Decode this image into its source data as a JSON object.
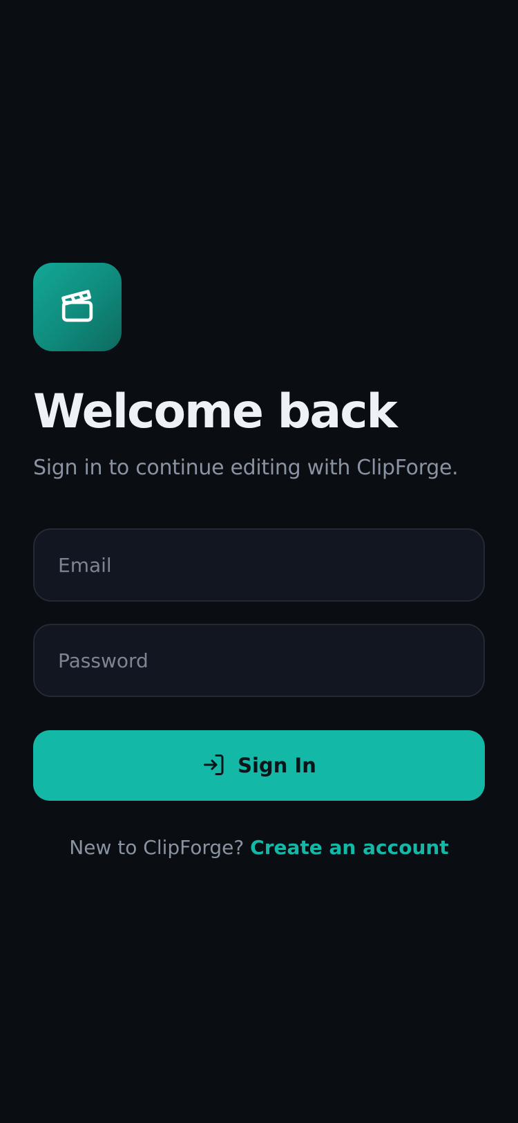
{
  "app": {
    "logo_icon": "clapperboard-icon",
    "accent_color": "#14b8a6",
    "background_color": "#0a0d12"
  },
  "header": {
    "title": "Welcome back",
    "subtitle": "Sign in to continue editing with ClipForge."
  },
  "form": {
    "email": {
      "placeholder": "Email",
      "value": ""
    },
    "password": {
      "placeholder": "Password",
      "value": ""
    },
    "submit": {
      "label": "Sign In",
      "icon": "log-in-icon"
    }
  },
  "footer": {
    "prompt": "New to ClipForge?",
    "link_label": "Create an account"
  }
}
